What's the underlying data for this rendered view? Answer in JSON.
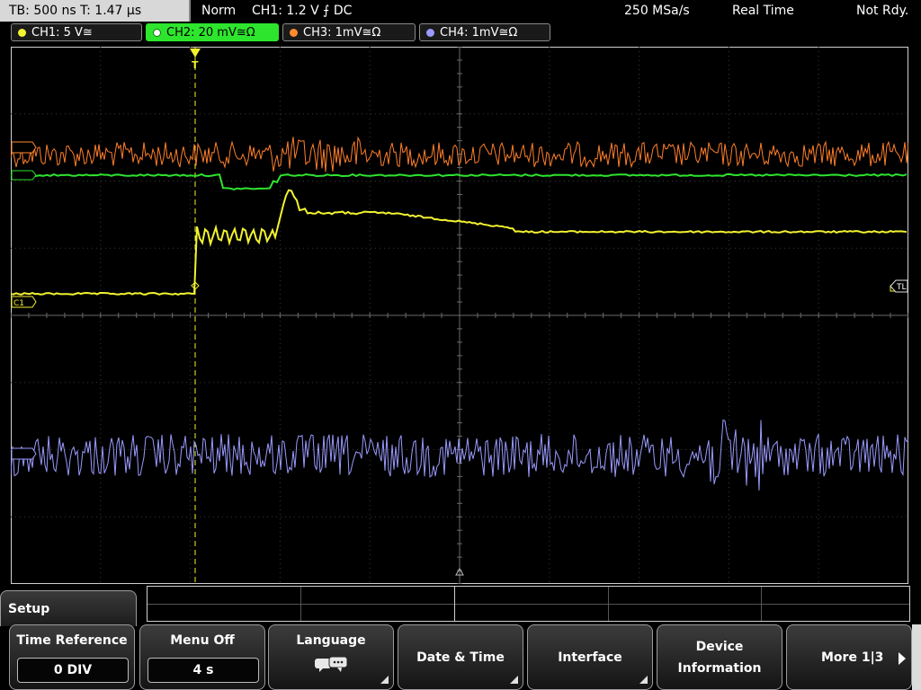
{
  "top": {
    "timebase": "TB: 500 ns   T: 1.47 µs",
    "mode": "Norm",
    "trigger": "CH1: 1.2 V ⨍ DC",
    "sample_rate": "250 MSa/s",
    "acq_mode": "Real Time",
    "status": "Not Rdy."
  },
  "channels": [
    {
      "label": "CH1: 5 V≅",
      "color": "#f2f230"
    },
    {
      "label": "CH2: 20 mV≅Ω",
      "color": "#2ee52e"
    },
    {
      "label": "CH3: 1mV≅Ω",
      "color": "#ff8a30"
    },
    {
      "label": "CH4: 1mV≅Ω",
      "color": "#9a9aff"
    }
  ],
  "markers": {
    "trigger_level": "TL",
    "c1": "C1"
  },
  "menu": {
    "title": "Setup",
    "time_reference": {
      "label": "Time Reference",
      "value": "0 DIV"
    },
    "menu_off": {
      "label": "Menu Off",
      "value": "4 s"
    },
    "language": {
      "label": "Language"
    },
    "date_time": {
      "label": "Date & Time"
    },
    "interface": {
      "label": "Interface"
    },
    "device_information": {
      "line1": "Device",
      "line2": "Information"
    },
    "more": {
      "label": "More 1|3"
    }
  },
  "icons": {
    "language": "speech-bubbles-icon",
    "more": "arrow-right-icon",
    "submenu": "submenu-corner-icon"
  }
}
